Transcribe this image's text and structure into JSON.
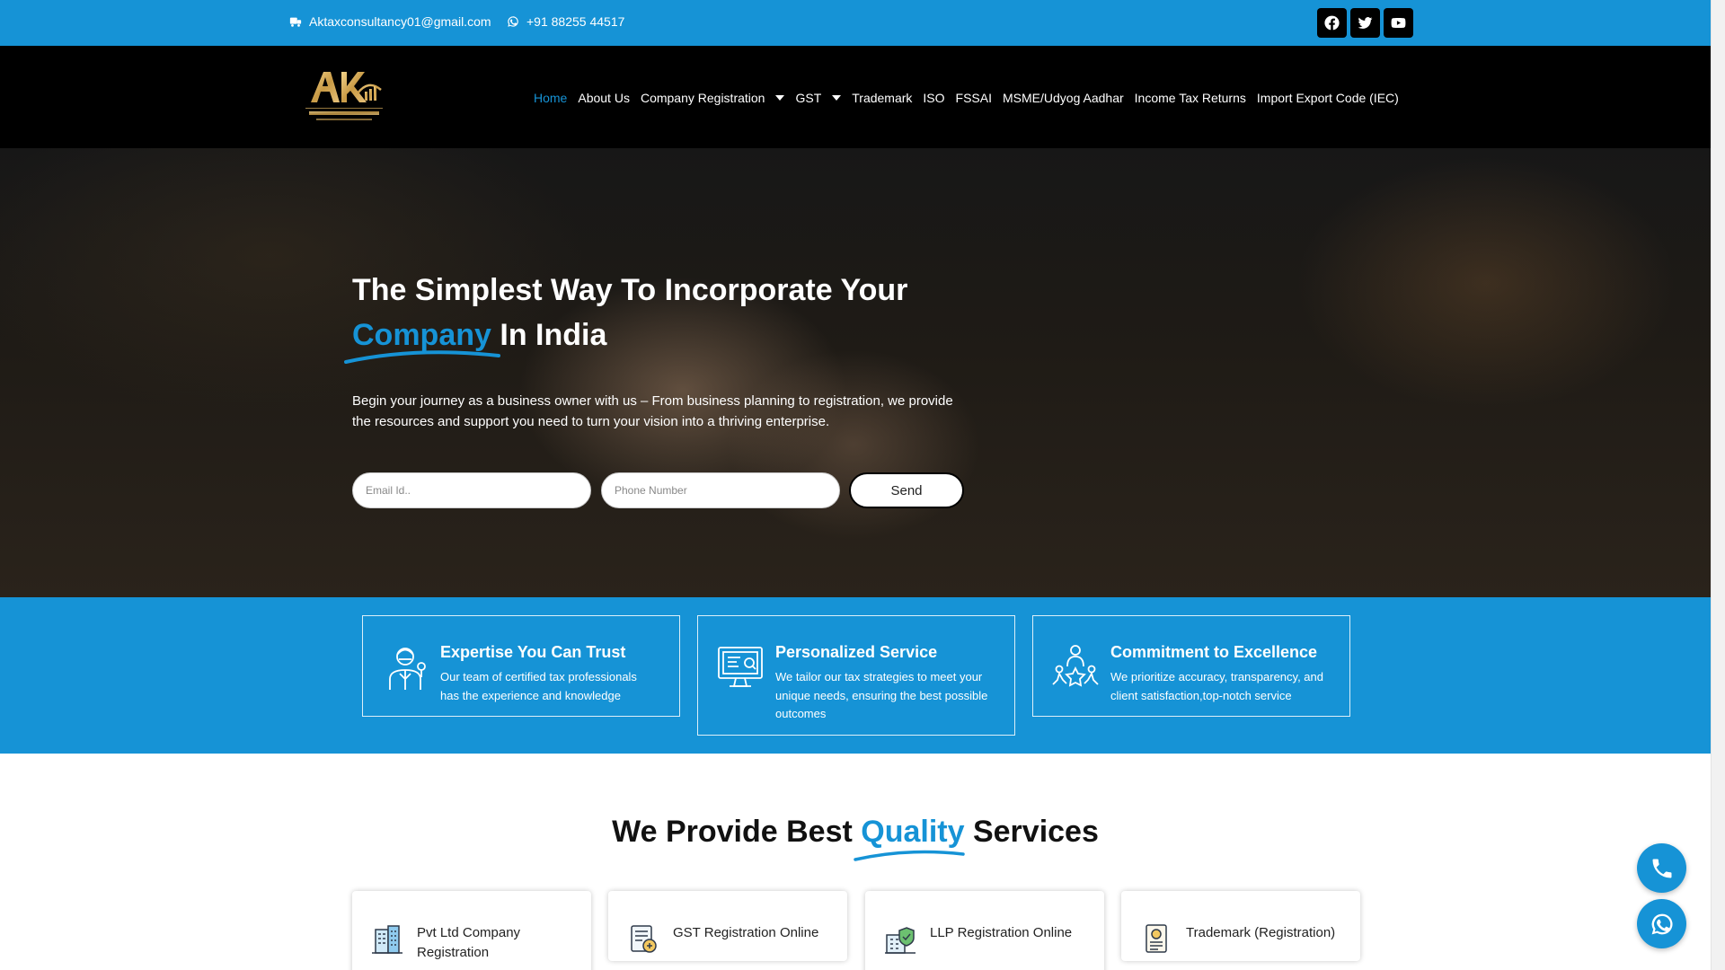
{
  "topbar": {
    "email": "Aktaxconsultancy01@gmail.com",
    "phone": "+91 88255 44517",
    "social": [
      "facebook-icon",
      "twitter-icon",
      "youtube-icon"
    ]
  },
  "header": {
    "logo_name": "AK TAX CONSULTANCY",
    "nav": [
      {
        "label": "Home",
        "active": true
      },
      {
        "label": "About Us"
      },
      {
        "label": "Company Registration",
        "dropdown": true
      },
      {
        "label": "GST",
        "dropdown": true
      },
      {
        "label": "Trademark"
      },
      {
        "label": "ISO"
      },
      {
        "label": "FSSAI"
      },
      {
        "label": "MSME/Udyog Aadhar"
      },
      {
        "label": "Income Tax Returns"
      },
      {
        "label": "Import Export Code (IEC)"
      }
    ]
  },
  "hero": {
    "title_line1": "The Simplest Way To Incorporate Your",
    "title_highlight": "Company",
    "title_rest": " In India",
    "description": "Begin your journey as a business owner with us – From business planning to registration, we provide the resources and support you need to turn your vision into a thriving enterprise.",
    "email_placeholder": "Email Id..",
    "phone_placeholder": "Phone Number",
    "send_label": "Send"
  },
  "features": [
    {
      "title": "Expertise You Can Trust",
      "desc": "Our team of certified tax professionals has the experience and knowledge",
      "icon": "expert-icon"
    },
    {
      "title": "Personalized Service",
      "desc": "We tailor our tax strategies to meet your unique needs, ensuring the best possible outcomes",
      "icon": "computer-icon"
    },
    {
      "title": "Commitment to Excellence",
      "desc": "We prioritize accuracy, transparency, and client satisfaction,top-notch service",
      "icon": "team-star-icon"
    }
  ],
  "services": {
    "title_pre": "We Provide Best ",
    "title_highlight": "Quality",
    "title_post": " Services",
    "items": [
      {
        "label": "Pvt Ltd Company Registration",
        "icon": "building-icon"
      },
      {
        "label": "GST Registration Online",
        "icon": "gst-icon"
      },
      {
        "label": "LLP Registration Online",
        "icon": "llp-icon"
      },
      {
        "label": "Trademark (Registration)",
        "icon": "trademark-icon"
      }
    ]
  },
  "colors": {
    "accent": "#1693d6",
    "dark": "#000000"
  }
}
